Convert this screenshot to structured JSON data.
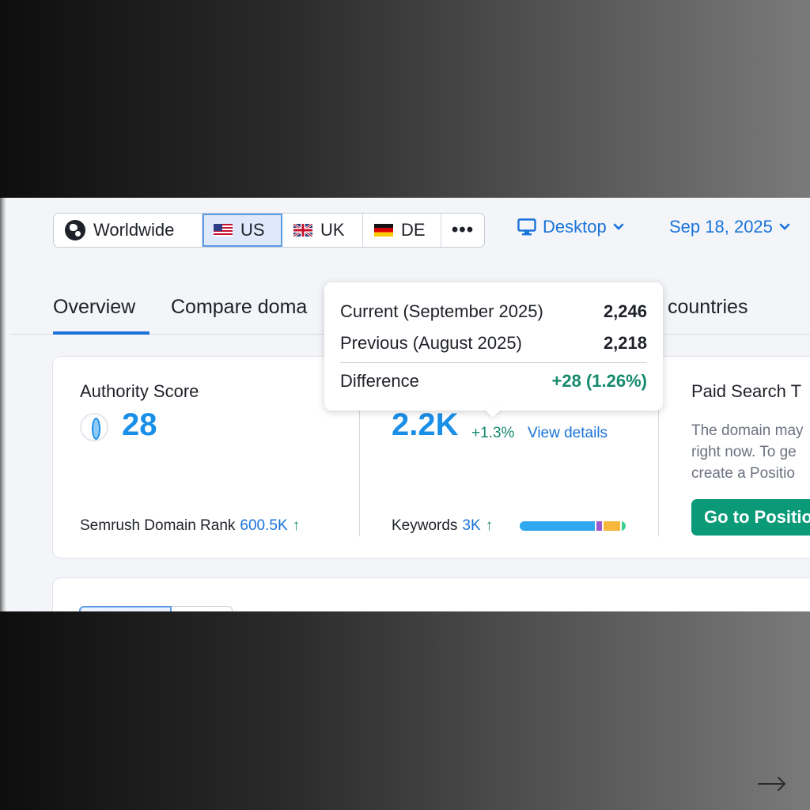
{
  "regions": {
    "worldwide": "Worldwide",
    "us": "US",
    "uk": "UK",
    "de": "DE",
    "more": "•••",
    "selected": "US"
  },
  "device": {
    "label": "Desktop"
  },
  "date": {
    "label": "Sep 18, 2025"
  },
  "tabs": {
    "overview": "Overview",
    "compare": "Compare doma",
    "countries": "countries",
    "active": "Overview"
  },
  "authority": {
    "label": "Authority Score",
    "value": "28",
    "rank_label": "Semrush Domain Rank",
    "rank_value": "600.5K",
    "rank_arrow": "↑"
  },
  "traffic": {
    "value": "2.2K",
    "change": "+1.3%",
    "view_details": "View details",
    "keywords_label": "Keywords",
    "keywords_value": "3K",
    "keywords_arrow": "↑"
  },
  "keyword_bar": [
    {
      "share": 0.72,
      "color": "#2fa8f0"
    },
    {
      "share": 0.05,
      "color": "#9b59d0"
    },
    {
      "share": 0.16,
      "color": "#f6b73c"
    },
    {
      "share": 0.04,
      "color": "#3fcf8e"
    }
  ],
  "paid": {
    "title": "Paid Search T",
    "text_line1": "The domain may",
    "text_line2": "right now. To ge",
    "text_line3": "create a Positio",
    "button": "Go to Positio"
  },
  "tooltip": {
    "current_label": "Current (September 2025)",
    "current_value": "2,246",
    "previous_label": "Previous (August 2025)",
    "previous_value": "2,218",
    "difference_label": "Difference",
    "difference_value": "+28 (1.26%)"
  },
  "colors": {
    "accent": "#1a73d9",
    "metric": "#1a8fe8",
    "positive": "#168a6e",
    "button": "#0a9a78"
  },
  "icons": {
    "globe": "globe-icon",
    "monitor": "monitor-icon",
    "chevron": "chevron-down-icon",
    "next": "arrow-right-icon"
  }
}
